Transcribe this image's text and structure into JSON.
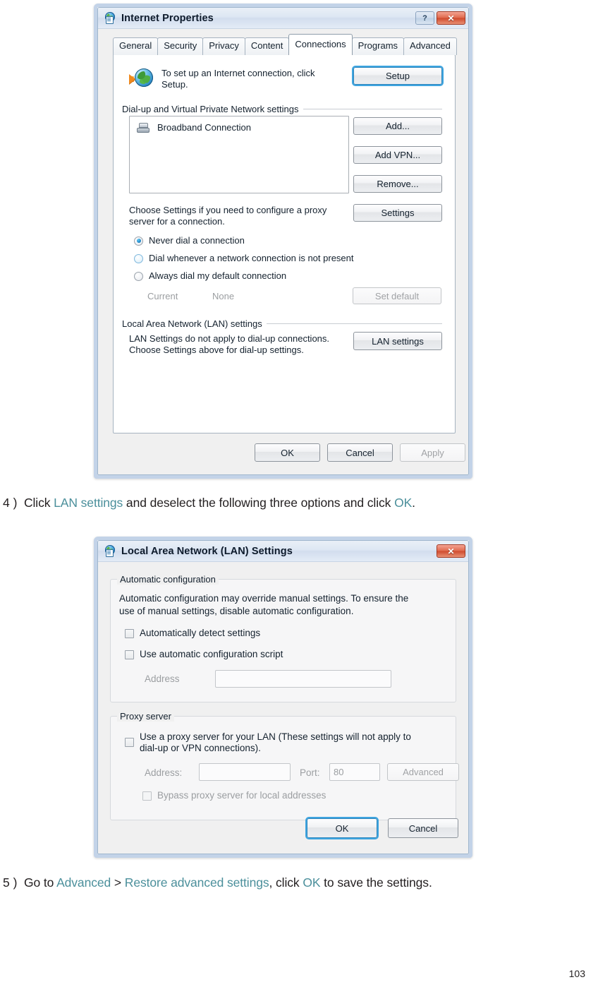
{
  "internet_properties": {
    "title": "Internet Properties",
    "window_icon": "internet-properties-icon",
    "help_button": "?",
    "close_button": "✕",
    "tabs": [
      {
        "label": "General",
        "active": false
      },
      {
        "label": "Security",
        "active": false
      },
      {
        "label": "Privacy",
        "active": false
      },
      {
        "label": "Content",
        "active": false
      },
      {
        "label": "Connections",
        "active": true
      },
      {
        "label": "Programs",
        "active": false
      },
      {
        "label": "Advanced",
        "active": false
      }
    ],
    "setup_text": "To set up an Internet connection, click Setup.",
    "setup_button": "Setup",
    "dialup_group_label": "Dial-up and Virtual Private Network settings",
    "connection_list": [
      {
        "name": "Broadband Connection",
        "icon": "modem-icon"
      }
    ],
    "side_buttons": [
      {
        "label": "Add...",
        "disabled": false
      },
      {
        "label": "Add VPN...",
        "disabled": false
      },
      {
        "label": "Remove...",
        "disabled": false
      },
      {
        "label": "Settings",
        "disabled": false
      }
    ],
    "choose_settings_text_line1": "Choose Settings if you need to configure a proxy",
    "choose_settings_text_line2": "server for a connection.",
    "dial_options": [
      {
        "label": "Never dial a connection",
        "selected": true
      },
      {
        "label": "Dial whenever a network connection is not present",
        "selected": false
      },
      {
        "label": "Always dial my default connection",
        "selected": false
      }
    ],
    "current_label": "Current",
    "current_value": "None",
    "set_default_button": "Set default",
    "lan_group_label": "Local Area Network (LAN) settings",
    "lan_text_line1": "LAN Settings do not apply to dial-up connections.",
    "lan_text_line2": "Choose Settings above for dial-up settings.",
    "lan_settings_button": "LAN settings",
    "footer_buttons": [
      {
        "label": "OK",
        "disabled": false
      },
      {
        "label": "Cancel",
        "disabled": false
      },
      {
        "label": "Apply",
        "disabled": true
      }
    ]
  },
  "step4": {
    "number": "4 )",
    "part1": "Click ",
    "link1": "LAN settings",
    "part2": " and deselect the following three options and click ",
    "link2": "OK",
    "part3": "."
  },
  "lan_settings": {
    "title": "Local Area Network (LAN) Settings",
    "window_icon": "lan-settings-icon",
    "close_button": "✕",
    "auto_config": {
      "group_label": "Automatic configuration",
      "description_line1": "Automatic configuration may override manual settings.  To ensure the",
      "description_line2": "use of manual settings, disable automatic configuration.",
      "checkbox_detect": {
        "label": "Automatically detect settings",
        "checked": false
      },
      "checkbox_script": {
        "label": "Use automatic configuration script",
        "checked": false
      },
      "address_label": "Address",
      "address_value": "",
      "address_disabled": true
    },
    "proxy": {
      "group_label": "Proxy server",
      "checkbox_proxy": {
        "label_line1": "Use a proxy server for your LAN (These settings will not apply to",
        "label_line2": "dial-up or VPN connections).",
        "checked": false
      },
      "address_label": "Address:",
      "address_value": "",
      "port_label": "Port:",
      "port_value": "80",
      "advanced_button": "Advanced",
      "checkbox_bypass": {
        "label": "Bypass proxy server for local addresses",
        "checked": false
      }
    },
    "footer_buttons": [
      {
        "label": "OK",
        "disabled": false,
        "focused": true
      },
      {
        "label": "Cancel",
        "disabled": false,
        "focused": false
      }
    ]
  },
  "step5": {
    "number": "5 )",
    "part1": "Go to ",
    "link1": "Advanced",
    "part2": " > ",
    "link2": "Restore advanced settings",
    "part3": ", click ",
    "link3": "OK",
    "part4": " to save the settings."
  },
  "page_number": "103",
  "colors": {
    "link": "#4b8f9b",
    "accent_focus": "#3ea5e0",
    "close_red": "#cf4a2d",
    "dialog_border": "#c3d3e8"
  }
}
